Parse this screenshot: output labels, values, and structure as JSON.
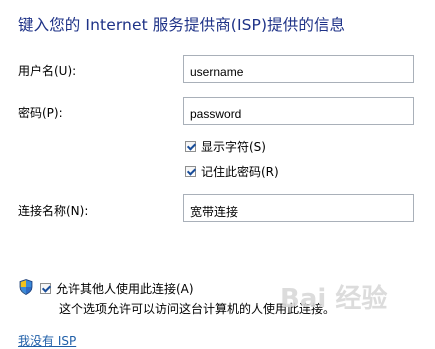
{
  "title": "键入您的 Internet 服务提供商(ISP)提供的信息",
  "username": {
    "label": "用户名(U):",
    "value": "username"
  },
  "password": {
    "label": "密码(P):",
    "value": "password"
  },
  "show_chars": {
    "label": "显示字符(S)",
    "checked": true
  },
  "remember_password": {
    "label": "记住此密码(R)",
    "checked": true
  },
  "connection_name": {
    "label": "连接名称(N):",
    "value": "宽带连接"
  },
  "allow_others": {
    "label": "允许其他人使用此连接(A)",
    "checked": true,
    "note": "这个选项允许可以访问这台计算机的人使用此连接。"
  },
  "no_isp_link": "我没有 ISP",
  "watermark": "Bai 经验",
  "icons": {
    "shield": "uac-shield-icon"
  },
  "colors": {
    "title": "#1e3287",
    "link": "#1f5fa8",
    "field_border": "#a9b0b9"
  }
}
